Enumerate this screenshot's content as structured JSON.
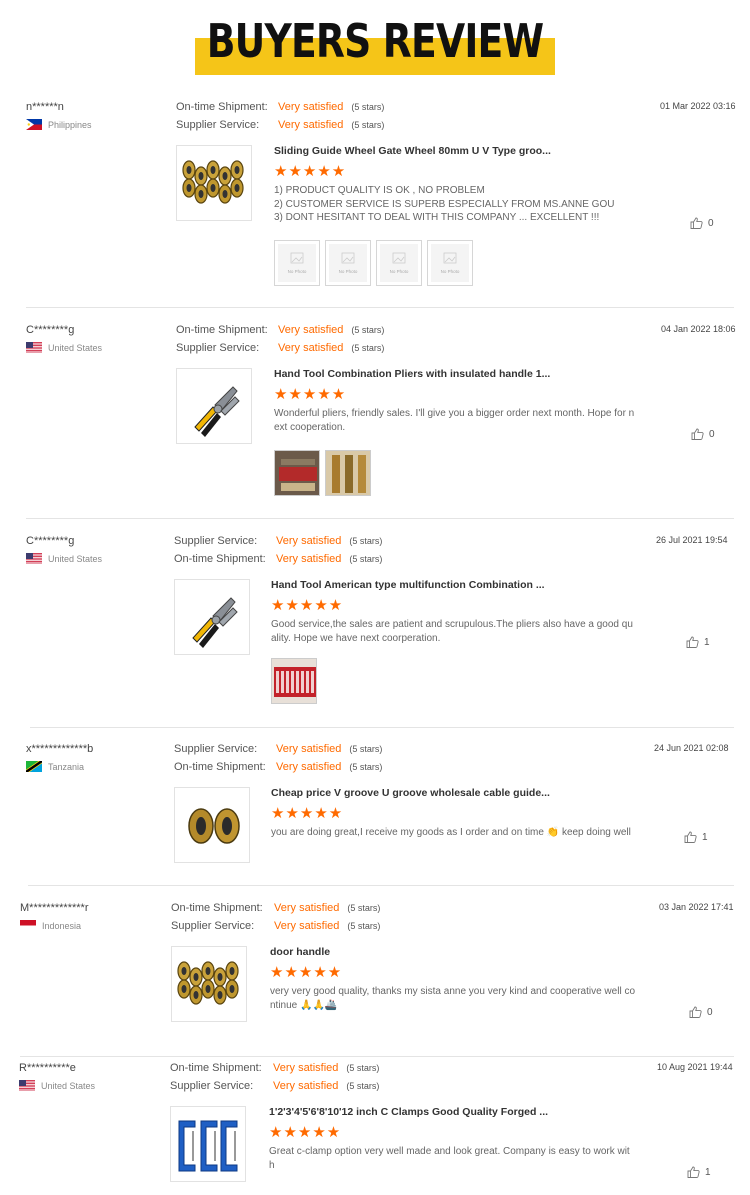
{
  "banner": {
    "title": "BUYERS REVIEW",
    "accent": "#f5c518"
  },
  "colors": {
    "rating": "#ff6a00",
    "stars": "#ff6a00"
  },
  "no_photo_label": "No Photo",
  "reviews": [
    {
      "user": "n******n",
      "country": "Philippines",
      "flag": "philippines-flag",
      "ratings": [
        {
          "label": "On-time Shipment:",
          "value": "Very satisfied",
          "stars": "(5 stars)"
        },
        {
          "label": "Supplier Service:",
          "value": "Very satisfied",
          "stars": "(5 stars)"
        }
      ],
      "date": "01 Mar 2022 03:16",
      "product": "Sliding Guide Wheel Gate Wheel 80mm U V Type groo...",
      "rating_stars": "★★★★★",
      "text": [
        "1) PRODUCT QUALITY IS OK , NO PROBLEM",
        "2) CUSTOMER SERVICE IS SUPERB ESPECIALLY FROM MS.ANNE GOU",
        "3) DONT HESITANT TO DEAL WITH THIS COMPANY ... EXCELLENT !!!"
      ],
      "likes": "0",
      "photos": 4,
      "photo_kind": "none"
    },
    {
      "user": "C********g",
      "country": "United States",
      "flag": "us-flag",
      "ratings": [
        {
          "label": "On-time Shipment:",
          "value": "Very satisfied",
          "stars": "(5 stars)"
        },
        {
          "label": "Supplier Service:",
          "value": "Very satisfied",
          "stars": "(5 stars)"
        }
      ],
      "date": "04 Jan 2022 18:06",
      "product": "Hand Tool Combination Pliers with insulated handle 1...",
      "rating_stars": "★★★★★",
      "text": [
        "Wonderful pliers, friendly sales. I'll give you a bigger order next month. Hope for n",
        "ext cooperation."
      ],
      "likes": "0",
      "photos": 2,
      "photo_kind": "pliers"
    },
    {
      "user": "C********g",
      "country": "United States",
      "flag": "us-flag",
      "ratings": [
        {
          "label": "Supplier Service:",
          "value": "Very satisfied",
          "stars": "(5 stars)"
        },
        {
          "label": "On-time Shipment:",
          "value": "Very satisfied",
          "stars": "(5 stars)"
        }
      ],
      "date": "26 Jul 2021 19:54",
      "product": "Hand Tool American type multifunction Combination ...",
      "rating_stars": "★★★★★",
      "text": [
        "Good service,the sales are patient and scrupulous.The pliers also have a good qu",
        "ality. Hope we have next coorperation."
      ],
      "likes": "1",
      "photos": 1,
      "photo_kind": "red"
    },
    {
      "user": "x*************b",
      "country": "Tanzania",
      "flag": "tanzania-flag",
      "ratings": [
        {
          "label": "Supplier Service:",
          "value": "Very satisfied",
          "stars": "(5 stars)"
        },
        {
          "label": "On-time Shipment:",
          "value": "Very satisfied",
          "stars": "(5 stars)"
        }
      ],
      "date": "24 Jun 2021 02:08",
      "product": "Cheap price V groove U groove wholesale cable guide...",
      "rating_stars": "★★★★★",
      "text": [
        "you are doing great,I receive my goods as I order and on time 👏 keep doing well"
      ],
      "likes": "1",
      "photos": 0,
      "photo_kind": "none"
    },
    {
      "user": "M*************r",
      "country": "Indonesia",
      "flag": "indonesia-flag",
      "ratings": [
        {
          "label": "On-time Shipment:",
          "value": "Very satisfied",
          "stars": "(5 stars)"
        },
        {
          "label": "Supplier Service:",
          "value": "Very satisfied",
          "stars": "(5 stars)"
        }
      ],
      "date": "03 Jan 2022 17:41",
      "product": "door handle",
      "rating_stars": "★★★★★",
      "text": [
        "very very good quality, thanks my sista anne you very kind and cooperative well co",
        "ntinue 🙏🙏🚢"
      ],
      "likes": "0",
      "photos": 0,
      "photo_kind": "none"
    },
    {
      "user": "R**********e",
      "country": "United States",
      "flag": "us-flag",
      "ratings": [
        {
          "label": "On-time Shipment:",
          "value": "Very satisfied",
          "stars": "(5 stars)"
        },
        {
          "label": "Supplier Service:",
          "value": "Very satisfied",
          "stars": "(5 stars)"
        }
      ],
      "date": "10 Aug 2021 19:44",
      "product": "1'2'3'4'5'6'8'10'12 inch C Clamps Good Quality Forged ...",
      "rating_stars": "★★★★★",
      "text": [
        "Great c-clamp option very well made and look great.  Company is easy to work wit",
        "h"
      ],
      "likes": "1",
      "photos": 0,
      "photo_kind": "none"
    }
  ]
}
